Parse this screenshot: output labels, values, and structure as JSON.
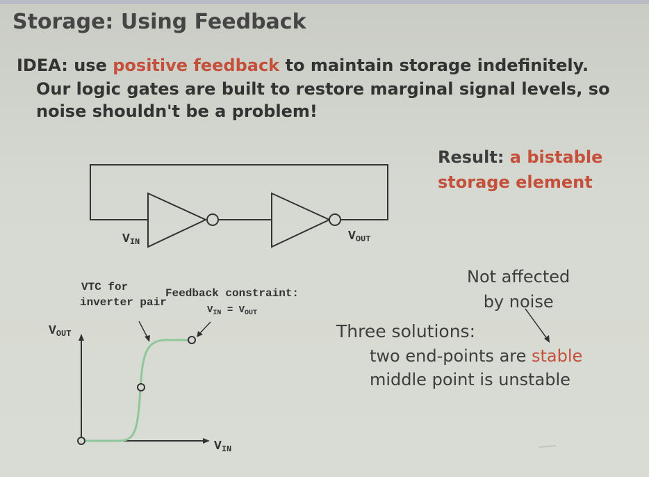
{
  "title": "Storage: Using Feedback",
  "idea": {
    "prefix": "IDEA: use ",
    "highlight": "positive feedback",
    "suffix": " to maintain storage indefinitely.",
    "line2": "Our logic gates are built to restore marginal signal levels, so",
    "line3": "noise shouldn't be a problem!"
  },
  "result": {
    "label": "Result: ",
    "highlight1": "a bistable",
    "highlight2": "storage element"
  },
  "circuit": {
    "vin_main": "V",
    "vin_sub": "IN",
    "vout_main": "V",
    "vout_sub": "OUT"
  },
  "graph": {
    "vtc_line1": "VTC for",
    "vtc_line2": "inverter pair",
    "feedback_line1": "Feedback constraint:",
    "feedback_eq_v1": "V",
    "feedback_eq_sub1": "IN",
    "feedback_eq_mid": " = V",
    "feedback_eq_sub2": "OUT",
    "yaxis_main": "V",
    "yaxis_sub": "OUT",
    "xaxis_main": "V",
    "xaxis_sub": "IN"
  },
  "notes": {
    "not_affected_line1": "Not affected",
    "not_affected_line2": "by noise",
    "three_solutions": "Three solutions:",
    "sol1_prefix": "two end-points are ",
    "sol1_highlight": "stable",
    "sol2": "middle point is unstable"
  },
  "colors": {
    "highlight": "#c4503c",
    "vtc_curve": "#8fc79a",
    "line": "#333333"
  },
  "icons": {
    "inverter1": "inverter-gate-icon",
    "inverter2": "inverter-gate-icon"
  }
}
